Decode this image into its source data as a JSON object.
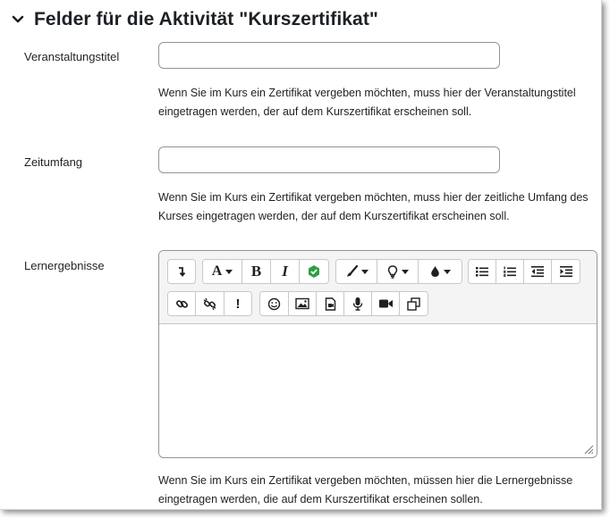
{
  "section": {
    "title": "Felder für die Aktivität \"Kurszertifikat\""
  },
  "fields": {
    "veranstaltungstitel": {
      "label": "Veranstaltungstitel",
      "value": "",
      "help": "Wenn Sie im Kurs ein Zertifikat vergeben möchten, muss hier der Veranstaltungstitel eingetragen werden, der auf dem Kurszertifikat erscheinen soll."
    },
    "zeitumfang": {
      "label": "Zeitumfang",
      "value": "",
      "help": "Wenn Sie im Kurs ein Zertifikat vergeben möchten, muss hier der zeitliche Umfang des Kurses eingetragen werden, der auf dem Kurszertifikat erscheinen soll."
    },
    "lernergebnisse": {
      "label": "Lernergebnisse",
      "value": "",
      "help": "Wenn Sie im Kurs ein Zertifikat vergeben möchten, müssen hier die Lernergebnisse eingetragen werden, die auf dem Kurszertifikat erscheinen sollen."
    }
  },
  "editor_toolbar": {
    "row1": [
      "collapse-icon",
      "font-size-icon",
      "bold-icon",
      "italic-icon",
      "accessibility-checker-icon",
      "brush-icon",
      "lightbulb-icon",
      "color-drop-icon",
      "bullet-list-icon",
      "numbered-list-icon",
      "outdent-icon",
      "indent-icon"
    ],
    "row2": [
      "link-icon",
      "unlink-icon",
      "exclamation-icon",
      "emoji-icon",
      "image-icon",
      "media-file-icon",
      "microphone-icon",
      "video-camera-icon",
      "copy-icon"
    ],
    "bold_glyph": "B",
    "italic_glyph": "I",
    "font_glyph": "A",
    "exclamation_glyph": "!"
  },
  "colors": {
    "accessibility_green": "#2e9e44",
    "border": "#8f959e"
  }
}
